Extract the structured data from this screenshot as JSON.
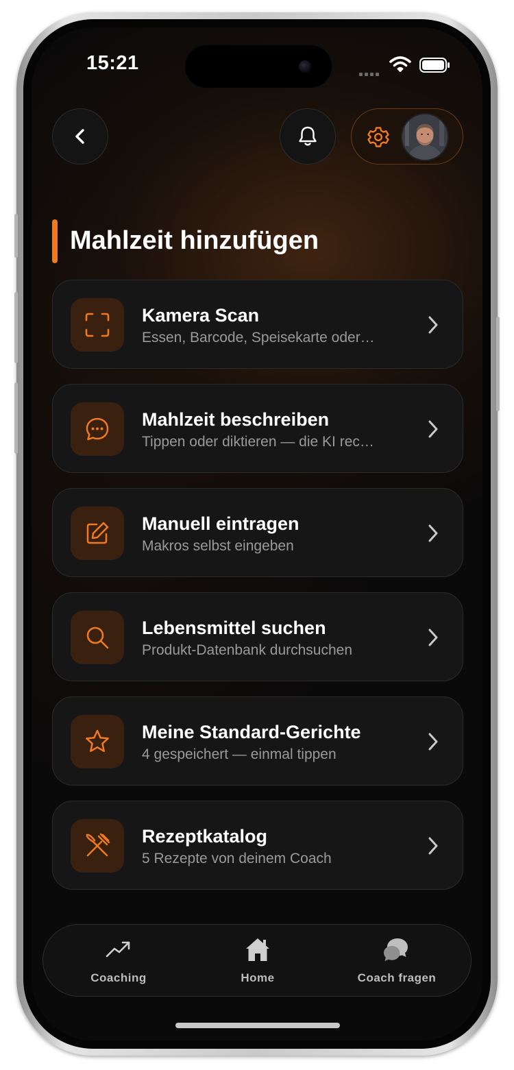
{
  "status": {
    "time": "15:21"
  },
  "header": {
    "back_icon": "chevron-left-icon",
    "bell_icon": "bell-icon",
    "gear_icon": "gear-icon",
    "accent": "#f07a22"
  },
  "page": {
    "title": "Mahlzeit hinzufügen"
  },
  "options": [
    {
      "icon": "scan-frame-icon",
      "title": "Kamera Scan",
      "subtitle": "Essen, Barcode, Speisekarte oder…"
    },
    {
      "icon": "chat-bubble-icon",
      "title": "Mahlzeit beschreiben",
      "subtitle": "Tippen oder diktieren — die KI rec…"
    },
    {
      "icon": "edit-icon",
      "title": "Manuell eintragen",
      "subtitle": "Makros selbst eingeben"
    },
    {
      "icon": "search-icon",
      "title": "Lebensmittel suchen",
      "subtitle": "Produkt-Datenbank durchsuchen"
    },
    {
      "icon": "star-icon",
      "title": "Meine Standard-Gerichte",
      "subtitle": "4 gespeichert — einmal tippen"
    },
    {
      "icon": "fork-knife-icon",
      "title": "Rezeptkatalog",
      "subtitle": "5 Rezepte von deinem Coach"
    }
  ],
  "tabs": [
    {
      "icon": "trend-up-icon",
      "label": "Coaching"
    },
    {
      "icon": "home-icon",
      "label": "Home"
    },
    {
      "icon": "chat-bubbles-icon",
      "label": "Coach fragen"
    }
  ]
}
